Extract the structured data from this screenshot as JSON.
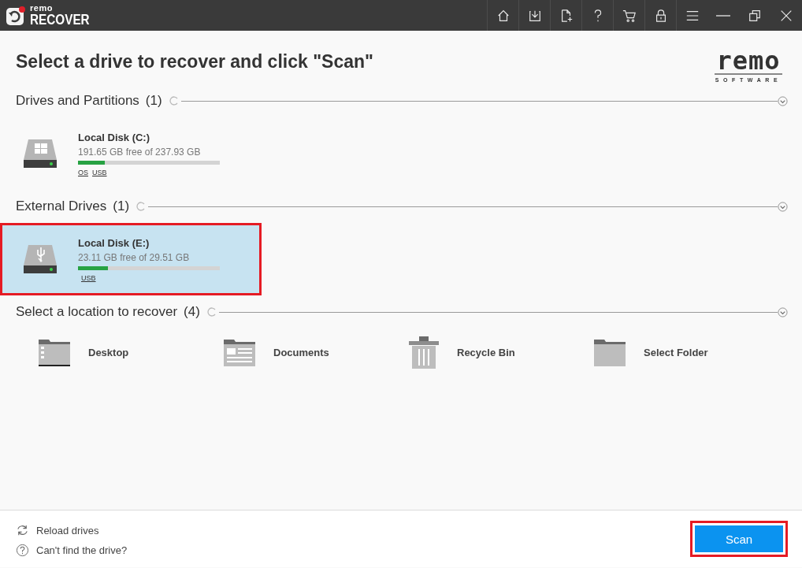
{
  "app": {
    "logo_small": "remo",
    "logo_big": "RECOVER"
  },
  "title_buttons": [
    {
      "kind": "home"
    },
    {
      "kind": "save"
    },
    {
      "kind": "new-file"
    },
    {
      "kind": "help"
    },
    {
      "kind": "cart"
    },
    {
      "kind": "lock"
    },
    {
      "kind": "menu"
    },
    {
      "kind": "minimize"
    },
    {
      "kind": "restore"
    },
    {
      "kind": "close"
    }
  ],
  "heading": "Select a drive to recover and click \"Scan\"",
  "brand": {
    "word": "remo",
    "tagline": "SOFTWARE"
  },
  "sections": [
    {
      "kind": "drives",
      "title": "Drives and Partitions",
      "count": "(1)",
      "expanded": true,
      "drives": [
        {
          "kind": "windows",
          "name": "Local Disk (C:)",
          "free": "191.65 GB free of 237.93 GB",
          "level": 0.19,
          "tags": [
            "OS",
            "USB"
          ],
          "selected": false
        }
      ]
    },
    {
      "kind": "drives",
      "title": "External Drives",
      "count": "(1)",
      "expanded": true,
      "drives": [
        {
          "kind": "usb",
          "name": "Local Disk (E:)",
          "free": "23.11 GB free of 29.51 GB",
          "level": 0.21,
          "tags": [
            "USB"
          ],
          "selected": true
        }
      ]
    },
    {
      "kind": "locations",
      "title": "Select a location to recover",
      "count": "(4)",
      "expanded": true,
      "locations": [
        {
          "kind": "desktop",
          "label": "Desktop"
        },
        {
          "kind": "documents",
          "label": "Documents"
        },
        {
          "kind": "recycle",
          "label": "Recycle Bin"
        },
        {
          "kind": "folder",
          "label": "Select Folder"
        }
      ]
    }
  ],
  "footer": {
    "links": [
      {
        "kind": "reload",
        "label": "Reload drives"
      },
      {
        "kind": "help",
        "label": "Can't find the drive?"
      }
    ],
    "scan": {
      "label": "Scan",
      "highlighted": true
    }
  }
}
